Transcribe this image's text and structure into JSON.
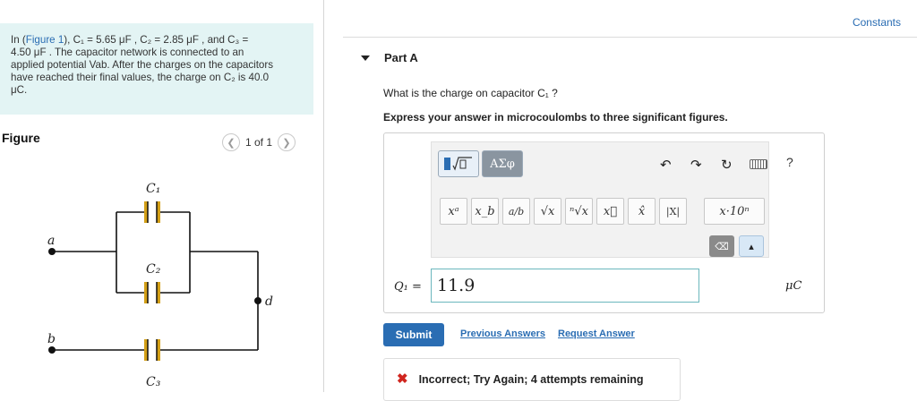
{
  "problem": {
    "prefix": "In (",
    "figure_link": "Figure 1",
    "line1_rest": "), C₁ = 5.65 μF , C₂ = 2.85 μF , and C₃ =",
    "line2": "4.50 μF . The capacitor network is connected to an",
    "line3": "applied potential Vab. After the charges on the capacitors",
    "line4": "have reached their final values, the charge on C₂ is 40.0",
    "line5": "μC."
  },
  "figure": {
    "title": "Figure",
    "pager_text": "1 of 1",
    "labels": {
      "c1": "C₁",
      "c2": "C₂",
      "c3": "C₃",
      "a": "a",
      "b": "b",
      "d": "d"
    },
    "colors": {
      "plate": "#d4a017",
      "wire": "#111111"
    }
  },
  "header": {
    "constants_link": "Constants"
  },
  "part": {
    "label": "Part A"
  },
  "question": {
    "text": "What is the charge on capacitor C₁ ?",
    "instruction": "Express your answer in microcoulombs to three significant figures."
  },
  "toolbar": {
    "symbol_button": "ΑΣφ",
    "undo_icon": "↶",
    "redo_icon": "↷",
    "reset_icon": "↻",
    "help": "?",
    "symbols": [
      "xᵃ",
      "x_b",
      "a/b",
      "√x",
      "ⁿ√x",
      "x⃗",
      "x̂",
      "|X|",
      "x·10ⁿ"
    ]
  },
  "answer": {
    "label": "Q₁ =",
    "value": "11.9",
    "unit": "μC"
  },
  "actions": {
    "submit": "Submit",
    "previous_answers": "Previous Answers",
    "request_answer": "Request Answer"
  },
  "feedback": {
    "icon": "✖",
    "text": "Incorrect; Try Again; 4 attempts remaining"
  },
  "colors": {
    "accent": "#2a6db3",
    "problem_bg": "#e3f4f4",
    "error": "#d0251e"
  }
}
